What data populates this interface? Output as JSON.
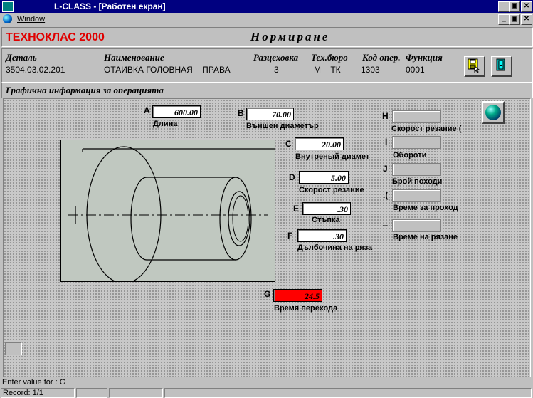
{
  "window": {
    "title": "L-CLASS - [Работен екран]",
    "menu_window": "Window",
    "min_glyph": "_",
    "max_glyph": "▣",
    "close_glyph": "✕"
  },
  "header": {
    "brand": "ТЕХНОКЛАС 2000",
    "module": "Нормиране"
  },
  "info": {
    "columns": [
      {
        "label": "Деталь",
        "value": "3504.03.02.201"
      },
      {
        "label": "Наименование",
        "value": "ОТАИВКА ГОЛОВНАЯ    ПРАВА"
      },
      {
        "label": "Разцеховка",
        "value": "3"
      },
      {
        "label": "Тех.бюро",
        "value": "М    ТК"
      },
      {
        "label": "Код опер.",
        "value": "1303"
      },
      {
        "label": "Функция",
        "value": "0001"
      }
    ]
  },
  "section": {
    "title": "Графична информация за операцията"
  },
  "params": {
    "A": {
      "letter": "A",
      "value": "600.00",
      "label": "Длина"
    },
    "B": {
      "letter": "B",
      "value": "70.00",
      "label": "Външен диаметър"
    },
    "C": {
      "letter": "C",
      "value": "20.00",
      "label": "Внутреный диамет"
    },
    "D": {
      "letter": "D",
      "value": "5.00",
      "label": "Скорост резание"
    },
    "E": {
      "letter": "E",
      "value": ".30",
      "label": "Стъпка"
    },
    "F": {
      "letter": "F",
      "value": ".30",
      "label": "Дълбочина на ряза"
    },
    "G": {
      "letter": "G",
      "value": "24.5",
      "label": "Время перехода"
    },
    "H": {
      "letter": "H",
      "value": "",
      "label": "Скорост резание ("
    },
    "I": {
      "letter": "I",
      "value": "",
      "label": "Обороти"
    },
    "J": {
      "letter": "J",
      "value": "",
      "label": "Брой походи"
    },
    "K": {
      "letter": ".(",
      "value": "",
      "label": "Време за проход"
    },
    "L": {
      "letter": "_",
      "value": "",
      "label": "Време на рязане"
    }
  },
  "status": {
    "prompt": "Enter value for : G",
    "record": "Record: 1/1"
  },
  "colors": {
    "brand": "#e00000",
    "titlebar": "#000080",
    "highlight_field": "#ff0000"
  }
}
